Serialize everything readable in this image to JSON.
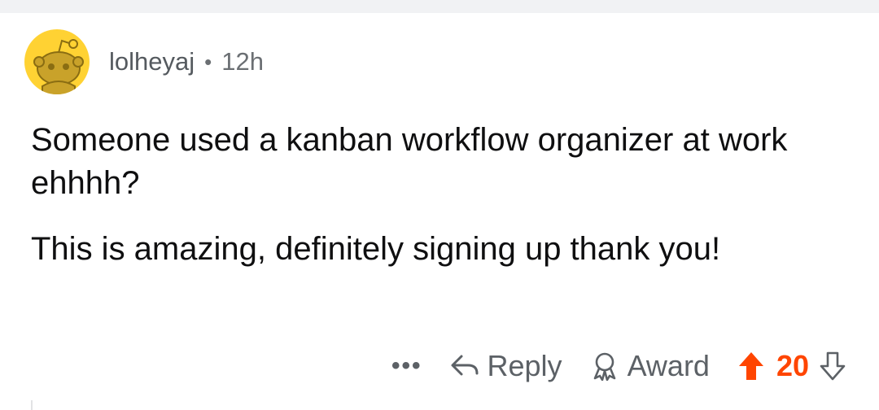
{
  "comment": {
    "author": "lolheyaj",
    "separator": "•",
    "age": "12h",
    "paragraphs": [
      "Someone used a kanban workflow organizer at work ehhhh?",
      "This is amazing, definitely signing up thank you!"
    ],
    "avatar_icon": "reddit-snoo-avatar",
    "avatar_color": "#ffd233"
  },
  "actions": {
    "more_label": "•••",
    "reply_label": "Reply",
    "award_label": "Award",
    "vote_count": "20",
    "upvote_color": "#ff4500"
  }
}
